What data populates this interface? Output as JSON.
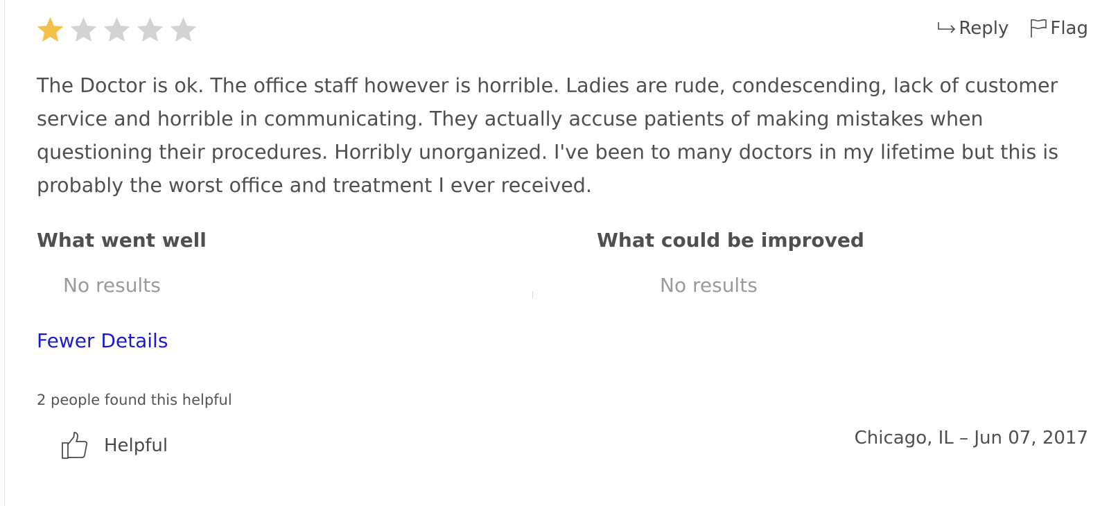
{
  "review": {
    "rating": 1,
    "rating_max": 5,
    "star_filled_color": "#f2c04b",
    "star_empty_color": "#d3d3d3",
    "text": "The Doctor is ok. The office staff however is horrible. Ladies are rude, condescending, lack of customer service and horrible in communicating. They actually accuse patients of making mistakes when questioning their procedures. Horribly unorganized. I've been to many doctors in my lifetime but this is probably the worst office and treatment I ever received.",
    "location_date": "Chicago, IL – Jun 07, 2017"
  },
  "actions": {
    "reply_label": "Reply",
    "flag_label": "Flag",
    "reply_icon": "reply-arrow-icon",
    "flag_icon": "flag-icon"
  },
  "details": {
    "went_well_title": "What went well",
    "went_well_empty": "No results",
    "improve_title": "What could be improved",
    "improve_empty": "No results",
    "toggle_label": "Fewer Details",
    "link_color": "#1a1ad6"
  },
  "helpful": {
    "count_text": "2 people found this helpful",
    "button_label": "Helpful",
    "icon": "thumbs-up-icon"
  }
}
